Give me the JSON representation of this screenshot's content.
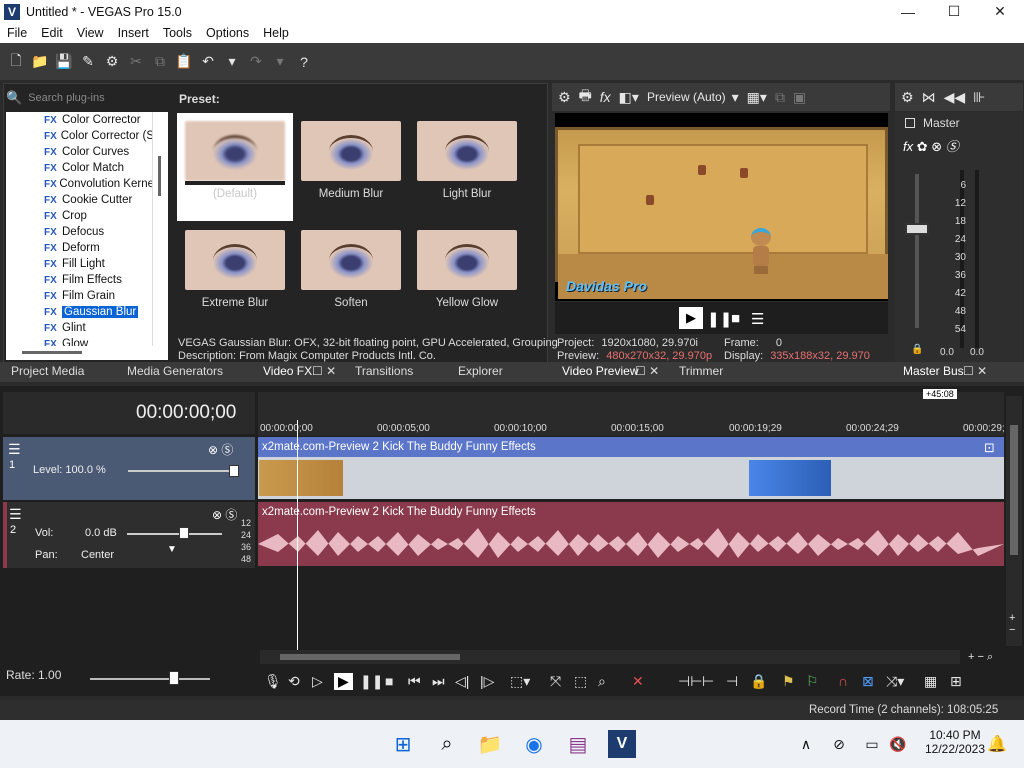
{
  "window": {
    "title": "Untitled * - VEGAS Pro 15.0",
    "app_icon_letter": "V",
    "minimize": "—",
    "maximize": "☐",
    "close": "✕"
  },
  "menu": [
    "File",
    "Edit",
    "View",
    "Insert",
    "Tools",
    "Options",
    "Help"
  ],
  "plugins": {
    "search_placeholder": "Search plug-ins",
    "preset_label": "Preset:",
    "items": [
      "Color Corrector",
      "Color Corrector (S",
      "Color Curves",
      "Color Match",
      "Convolution Kerne",
      "Cookie Cutter",
      "Crop",
      "Defocus",
      "Deform",
      "Fill Light",
      "Film Effects",
      "Film Grain",
      "Gaussian Blur",
      "Glint",
      "Glow"
    ],
    "selected_item": "Gaussian Blur",
    "presets": [
      "(Default)",
      "Medium Blur",
      "Light Blur",
      "Extreme Blur",
      "Soften",
      "Yellow Glow"
    ],
    "description_line1": "VEGAS Gaussian Blur: OFX, 32-bit floating point, GPU Accelerated, Grouping",
    "description_line2": "Description: From Magix Computer Products Intl. Co."
  },
  "preview": {
    "mode": "Preview (Auto)",
    "overlay_title": "Davidas Pro",
    "project_label": "Project:",
    "project_value": "1920x1080, 29.970i",
    "preview_label": "Preview:",
    "preview_value": "480x270x32, 29.970p",
    "frame_label": "Frame:",
    "frame_value": "0",
    "display_label": "Display:",
    "display_value": "335x188x32, 29.970"
  },
  "master": {
    "label": "Master",
    "ticks": [
      "6",
      "12",
      "18",
      "24",
      "30",
      "36",
      "42",
      "48",
      "54"
    ],
    "left_value": "0.0",
    "right_value": "0.0"
  },
  "tabs": [
    "Project Media",
    "Media Generators",
    "Video FX",
    "Transitions",
    "Explorer",
    "Video Preview",
    "Trimmer",
    "Master Bus"
  ],
  "timeline": {
    "timecode": "00:00:00;00",
    "offset": "+45:08",
    "ruler": [
      "00:00:00;00",
      "00:00:05;00",
      "00:00:10;00",
      "00:00:15;00",
      "00:00:19;29",
      "00:00:24;29",
      "00:00:29;"
    ],
    "track1": {
      "number": "1",
      "level": "Level: 100.0 %",
      "clip": "x2mate.com-Preview 2 Kick The Buddy Funny Effects"
    },
    "track2": {
      "number": "2",
      "vol_label": "Vol:",
      "vol_value": "0.0 dB",
      "pan_label": "Pan:",
      "pan_value": "Center",
      "db_ticks": [
        "12",
        "24",
        "36",
        "48"
      ],
      "clip": "x2mate.com-Preview 2 Kick The Buddy Funny Effects"
    },
    "rate": "Rate: 1.00"
  },
  "status": "Record Time (2 channels): 108:05:25",
  "taskbar": {
    "time": "10:40 PM",
    "date": "12/22/2023"
  }
}
